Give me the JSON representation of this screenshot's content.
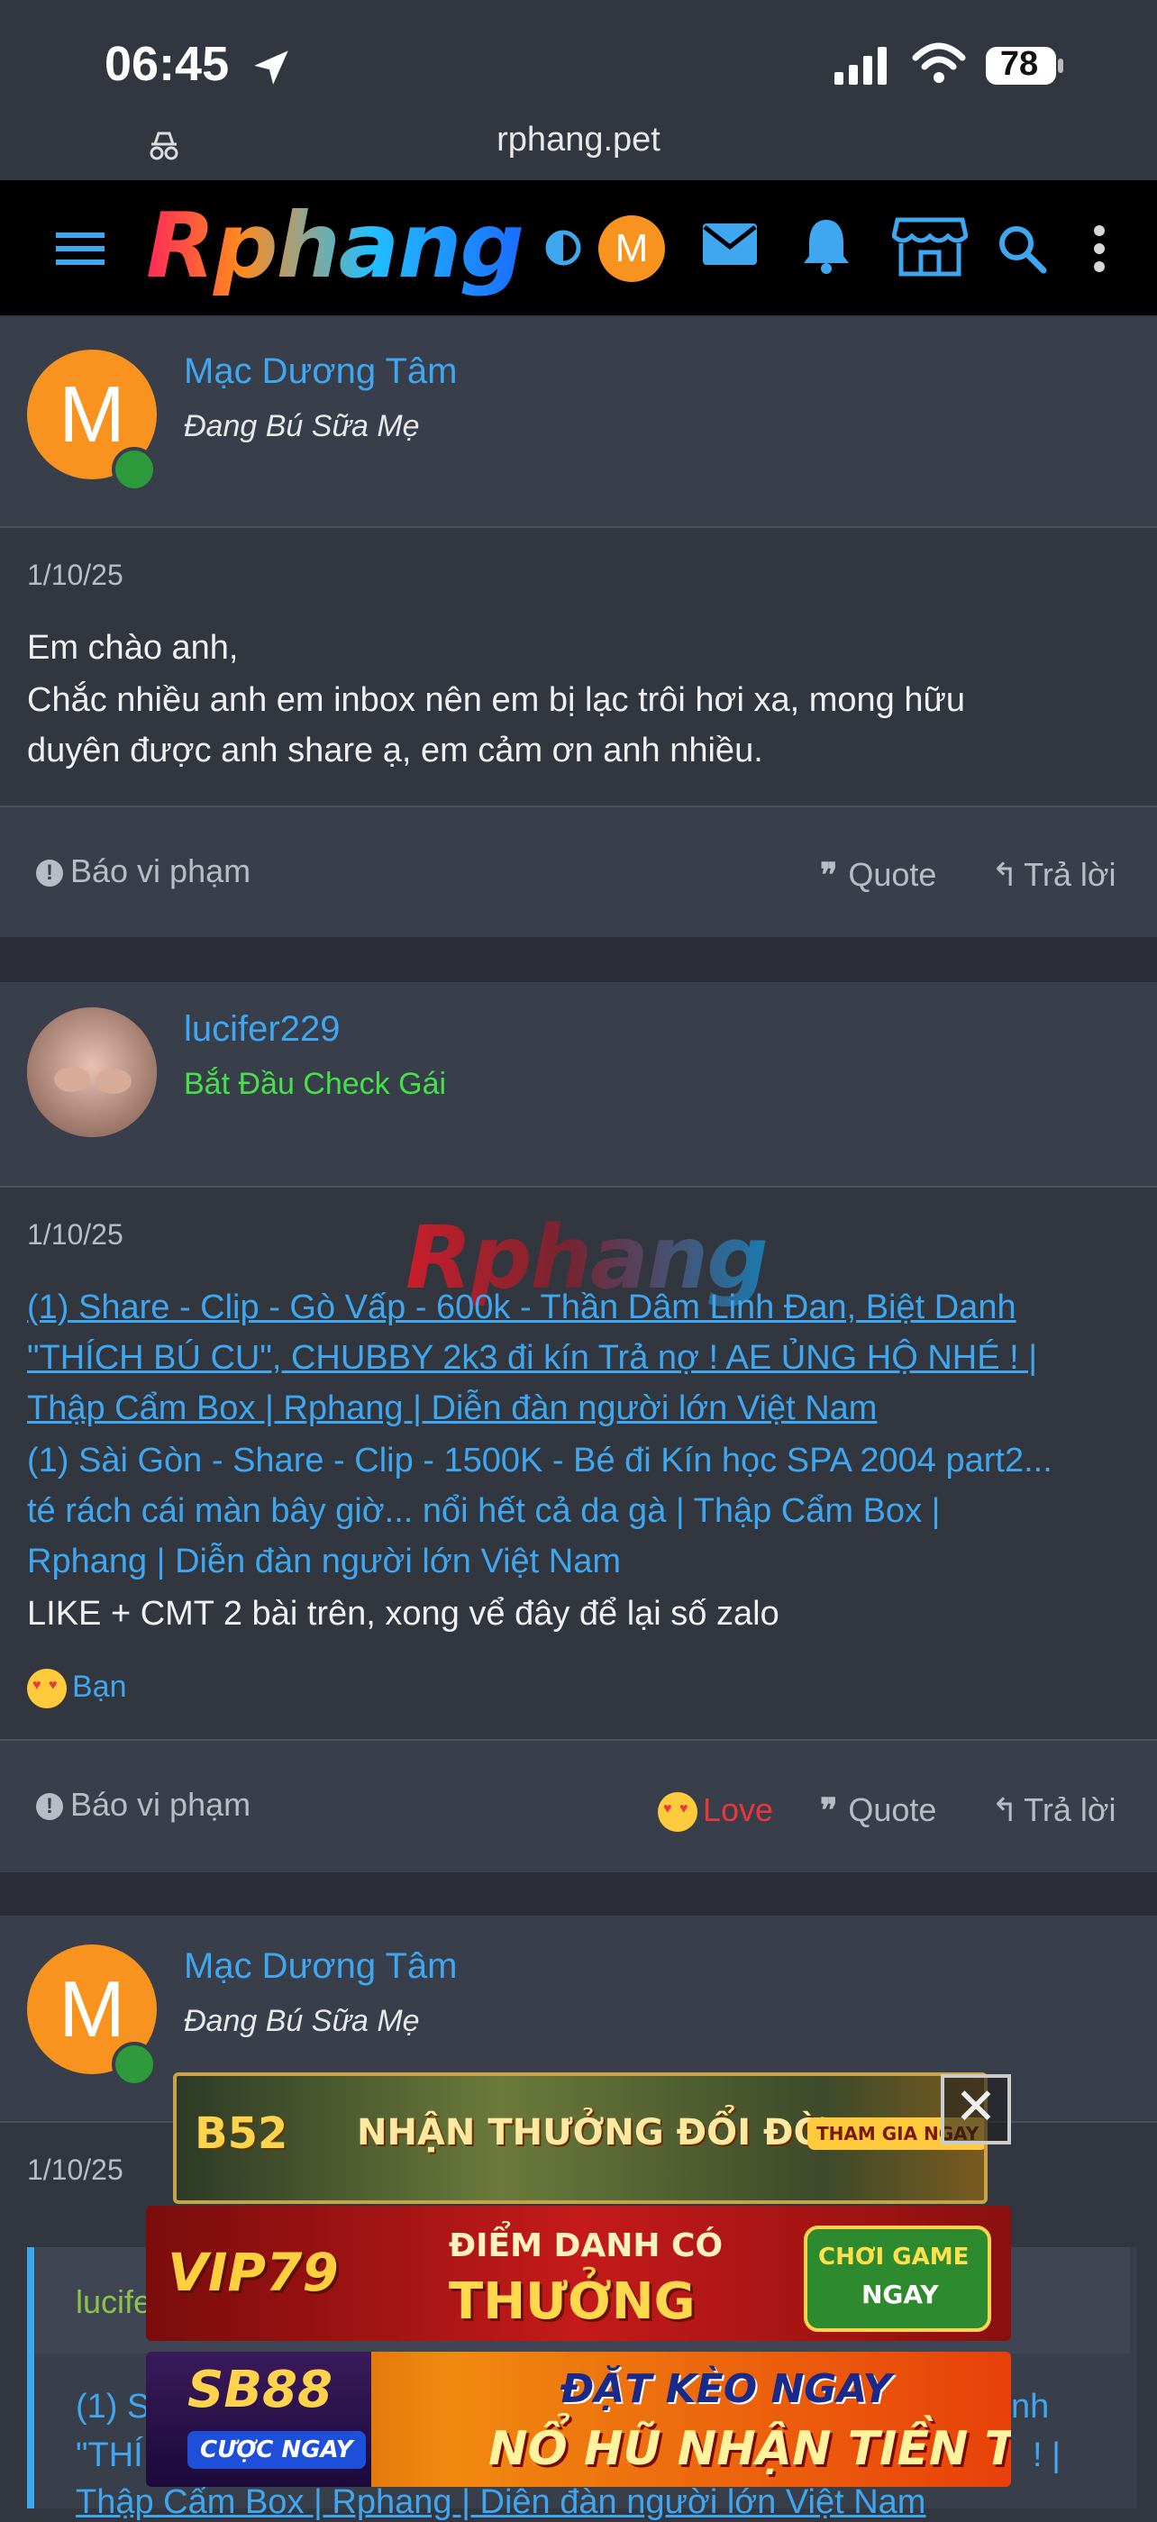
{
  "status": {
    "time": "06:45",
    "battery": "78"
  },
  "browser": {
    "url": "rphang.pet"
  },
  "nav": {
    "logo": "Rphang",
    "avatar_letter": "M"
  },
  "posts": [
    {
      "avatar_letter": "M",
      "username": "Mạc Dương Tâm",
      "user_title": "Đang Bú Sữa Mẹ",
      "date": "1/10/25",
      "lines": [
        "Em chào anh,",
        "Chắc nhiều anh em inbox nên em bị lạc trôi hơi xa, mong hữu",
        "duyên được anh share ạ, em cảm ơn anh nhiều."
      ],
      "report": "Báo vi phạm",
      "quote": "Quote",
      "reply": "Trả lời"
    },
    {
      "username": "lucifer229",
      "user_title": "Bắt Đầu Check Gái",
      "date": "1/10/25",
      "link1_lines": [
        "(1) Share - Clip - Gò Vấp - 600k - Thần Dâm Linh Đan, Biệt Danh",
        "\"THÍCH BÚ CU\", CHUBBY 2k3 đi kín Trả nợ ! AE ỦNG HỘ NHÉ ! |",
        "Thập Cẩm Box | Rphang | Diễn đàn người lớn Việt Nam"
      ],
      "link2_lines": [
        "(1) Sài Gòn - Share - Clip - 1500K - Bé đi Kín học SPA 2004 part2...",
        "té rách cái màn bây giờ... nổi hết cả da gà | Thập Cẩm Box |",
        "Rphang | Diễn đàn người lớn Việt Nam"
      ],
      "text": "LIKE + CMT 2 bài trên, xong vể đây để lại số zalo",
      "reaction_user": "Bạn",
      "report": "Báo vi phạm",
      "love": "Love",
      "quote": "Quote",
      "reply": "Trả lời"
    },
    {
      "avatar_letter": "M",
      "username": "Mạc Dương Tâm",
      "user_title": "Đang Bú Sữa Mẹ",
      "date": "1/10/25",
      "quote_author": "lucife",
      "quote_line1_start": "(1) S",
      "quote_line1_end": "nh",
      "quote_line2_start": "\"THÍ",
      "quote_line2_end": "! |",
      "quote_line3": "Thập Cẩm Box | Rphang | Diễn đàn người lớn Việt Nam"
    }
  ],
  "watermark": "Rphang",
  "ads": [
    {
      "brand": "B52",
      "text": "NHẬN THƯỞNG ĐỔI ĐỜI",
      "cta": "THAM GIA NGAY"
    },
    {
      "brand": "VIP79",
      "line1": "ĐIỂM DANH CÓ",
      "line2": "THƯỞNG",
      "cta1": "CHƠI GAME",
      "cta2": "NGAY"
    },
    {
      "brand": "SB88",
      "sub": "CƯỢC NGAY",
      "line1": "ĐẶT KÈO NGAY",
      "line2": "NỔ HŨ NHẬN TIỀN TỶ"
    }
  ],
  "colors": {
    "link": "#3fa7ef",
    "accent": "#f7931e",
    "love": "#e8383d",
    "title_green": "#45e04a"
  }
}
